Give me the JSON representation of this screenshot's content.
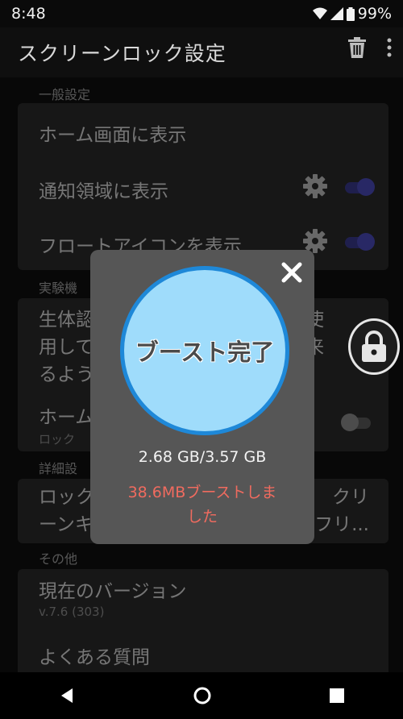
{
  "status": {
    "time": "8:48",
    "battery": "99%"
  },
  "app_bar": {
    "title": "スクリーンロック設定"
  },
  "sections": {
    "general": {
      "header": "一般設定",
      "items": [
        {
          "title": "ホーム画面に表示"
        },
        {
          "title": "通知領域に表示",
          "toggle": "on"
        },
        {
          "title": "フロートアイコンを表示",
          "toggle": "on"
        }
      ]
    },
    "experimental": {
      "header": "実験機",
      "items": [
        {
          "line1": "生体認",
          "line2": "用して",
          "line3": "るよう",
          "right_a": "使",
          "right_b": "来"
        },
        {
          "title": "ホーム",
          "sub": "ロック",
          "toggle": "off"
        }
      ]
    },
    "details": {
      "header": "詳細設",
      "items": [
        {
          "line1": "ロック",
          "line2": "ーンキ",
          "right_a": "クリ",
          "right_b": "フリ..."
        }
      ]
    },
    "other": {
      "header": "その他",
      "items": [
        {
          "title": "現在のバージョン",
          "sub": "v.7.6 (303)"
        },
        {
          "title": "よくある質問"
        }
      ]
    }
  },
  "dialog": {
    "boost_title": "ブースト完了",
    "memory": "2.68 GB/3.57 GB",
    "boosted_line1": "38.6MBブーストしま",
    "boosted_line2": "した"
  },
  "colors": {
    "accent": "#4a4ab8",
    "boost_circle": "#9fdcfb",
    "boost_ring": "#1e88d8",
    "boosted_text": "#f06b5f"
  }
}
